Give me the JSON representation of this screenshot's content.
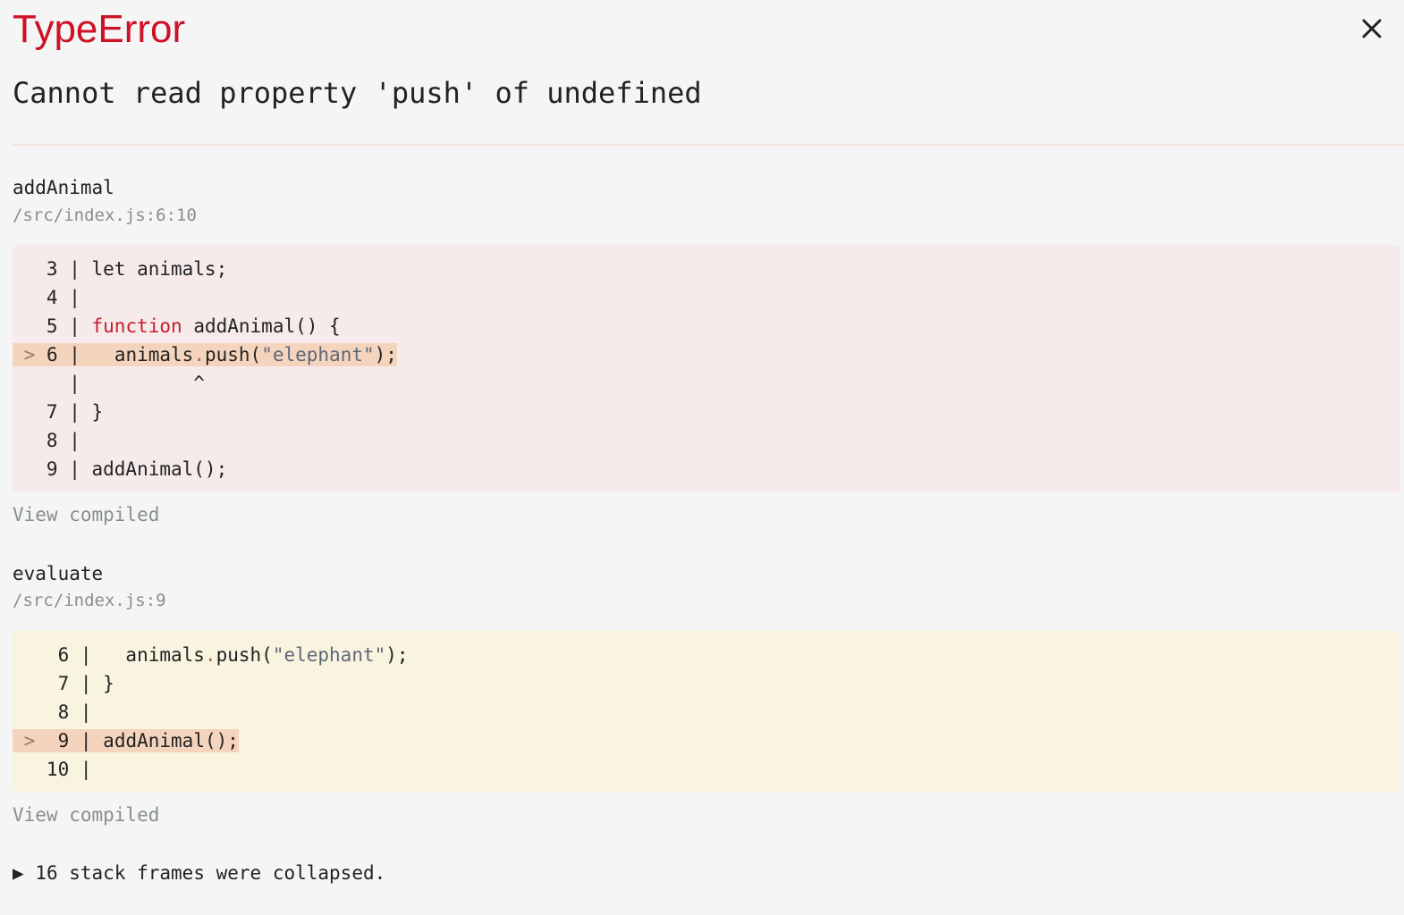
{
  "overlay": {
    "error_type": "TypeError",
    "message": "Cannot read property 'push' of undefined",
    "close_icon": "close-icon",
    "colors": {
      "error_red": "#ce1126",
      "error_block_bg": "#f6eaea",
      "app_block_bg": "#f8f4e0",
      "highlight_bg": "#f5d4be"
    }
  },
  "frames": [
    {
      "name": "addAnimal",
      "location": "/src/index.js:6:10",
      "view_compiled": "View compiled",
      "lines": [
        {
          "gutter": "   3 | ",
          "code": "let animals;",
          "active": false
        },
        {
          "gutter": "   4 | ",
          "code": "",
          "active": false
        },
        {
          "gutter": "   5 | ",
          "code": "function addAnimal() {",
          "active": false
        },
        {
          "gutter": " > 6 | ",
          "code": "  animals.push(\"elephant\");",
          "active": true
        },
        {
          "gutter": "     | ",
          "code": "         ^",
          "active": false
        },
        {
          "gutter": "   7 | ",
          "code": "}",
          "active": false
        },
        {
          "gutter": "   8 | ",
          "code": "",
          "active": false
        },
        {
          "gutter": "   9 | ",
          "code": "addAnimal();",
          "active": false
        }
      ]
    },
    {
      "name": "evaluate",
      "location": "/src/index.js:9",
      "view_compiled": "View compiled",
      "lines": [
        {
          "gutter": "    6 | ",
          "code": "  animals.push(\"elephant\");",
          "active": false
        },
        {
          "gutter": "    7 | ",
          "code": "}",
          "active": false
        },
        {
          "gutter": "    8 | ",
          "code": "",
          "active": false
        },
        {
          "gutter": " >  9 | ",
          "code": "addAnimal();",
          "active": true
        },
        {
          "gutter": "   10 | ",
          "code": "",
          "active": false
        }
      ]
    }
  ],
  "collapsed": {
    "toggle_icon": "triangle-right-icon",
    "glyph": "▶",
    "text": "16 stack frames were collapsed."
  }
}
